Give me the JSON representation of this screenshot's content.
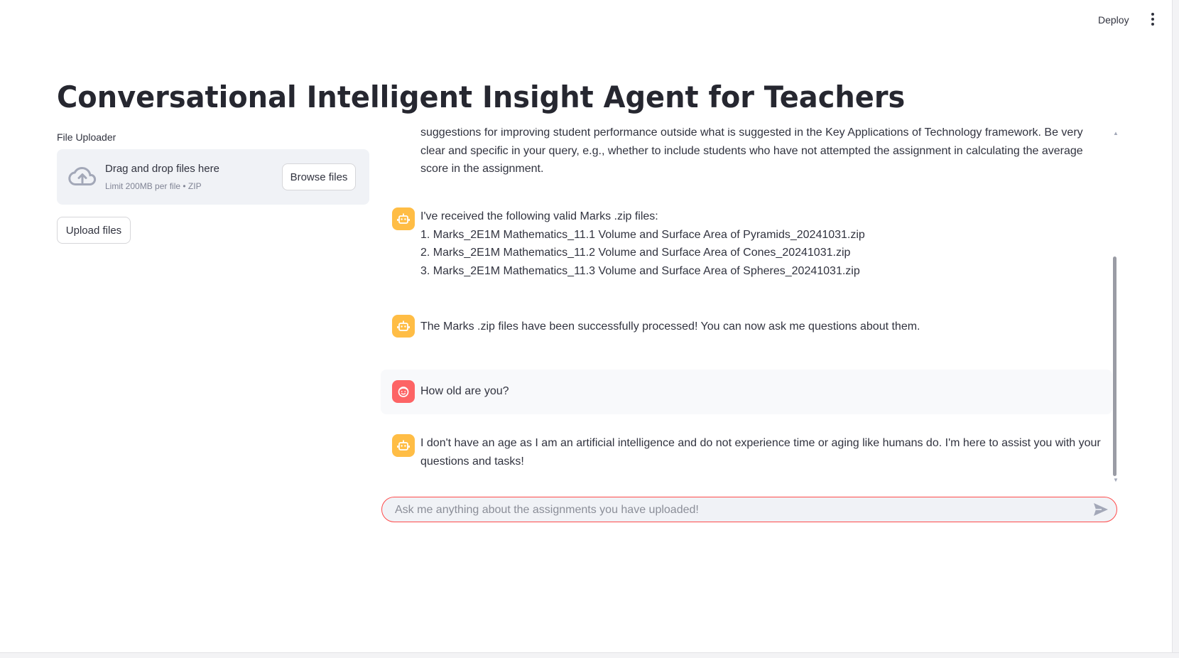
{
  "header": {
    "deploy_label": "Deploy",
    "menu_icon": "kebab-menu-icon"
  },
  "page": {
    "title": "Conversational Intelligent Insight Agent for Teachers"
  },
  "uploader": {
    "label": "File Uploader",
    "drop_text": "Drag and drop files here",
    "limit_text": "Limit 200MB per file • ZIP",
    "browse_label": "Browse files",
    "upload_label": "Upload files",
    "icon": "cloud-upload-icon"
  },
  "chat": {
    "messages": [
      {
        "role": "assistant",
        "lines": [
          "suggestions for improving student performance outside what is suggested in the Key Applications of Technology framework. Be very clear and specific in your query, e.g., whether to include students who have not attempted the assignment in calculating the average score in the assignment."
        ]
      },
      {
        "role": "assistant",
        "lines": [
          "I've received the following valid Marks .zip files:",
          "1. Marks_2E1M Mathematics_11.1 Volume and Surface Area of Pyramids_20241031.zip",
          "2. Marks_2E1M Mathematics_11.2 Volume and Surface Area of Cones_20241031.zip",
          "3. Marks_2E1M Mathematics_11.3 Volume and Surface Area of Spheres_20241031.zip"
        ]
      },
      {
        "role": "assistant",
        "lines": [
          "The Marks .zip files have been successfully processed! You can now ask me questions about them."
        ]
      },
      {
        "role": "user",
        "lines": [
          "How old are you?"
        ]
      },
      {
        "role": "assistant",
        "lines": [
          "I don't have an age as I am an artificial intelligence and do not experience time or aging like humans do. I'm here to assist you with your questions and tasks!"
        ]
      }
    ],
    "input": {
      "placeholder": "Ask me anything about the assignments you have uploaded!",
      "value": ""
    },
    "send_icon": "send-icon",
    "bot_icon": "robot-icon",
    "user_icon": "user-face-icon"
  },
  "colors": {
    "accent": "#ff4b4b",
    "bot_avatar": "#ffbd45",
    "dropzone_bg": "#f0f2f6",
    "text": "#31333f"
  }
}
